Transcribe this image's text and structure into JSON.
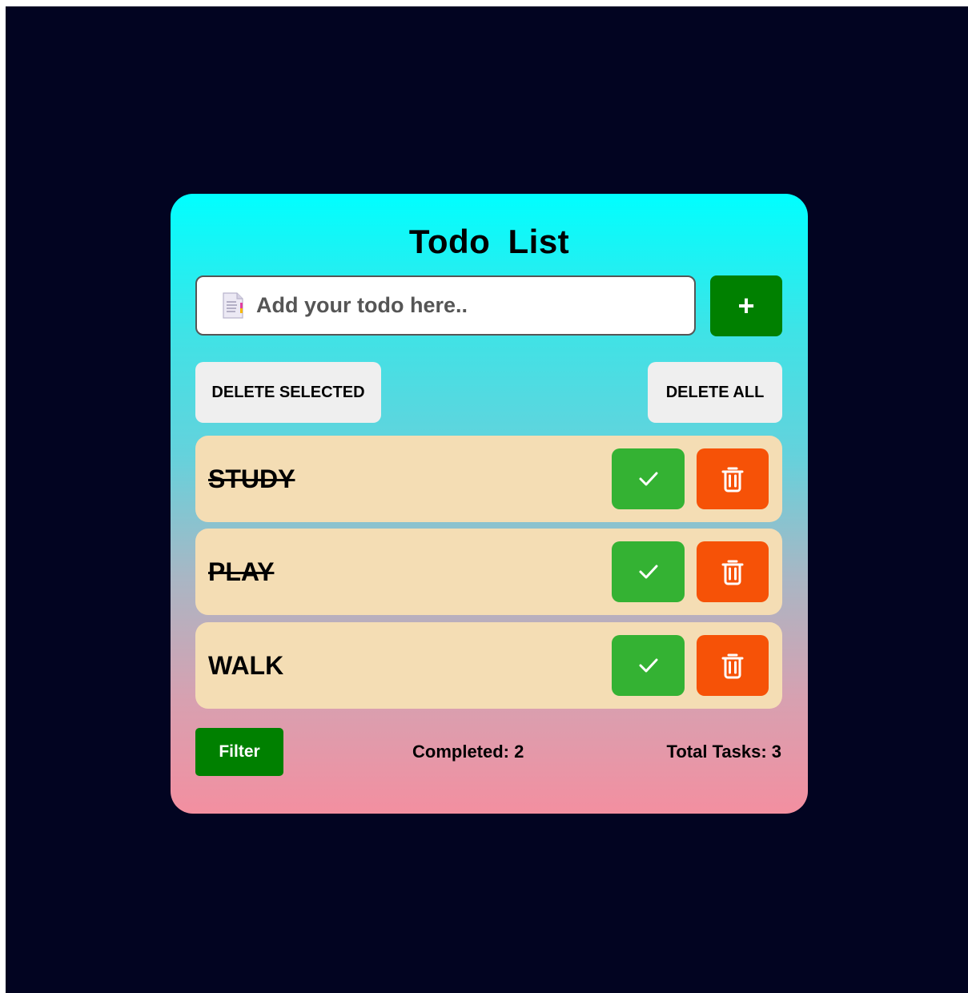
{
  "app": {
    "title": "Todo  List"
  },
  "input": {
    "placeholder": "Add your todo here..",
    "value": "",
    "icon": "notepad-icon"
  },
  "add_button": {
    "label": "+"
  },
  "actions": {
    "delete_selected_label": "DELETE SELECTED",
    "delete_all_label": "DELETE ALL"
  },
  "todos": [
    {
      "text": "STUDY",
      "completed": true
    },
    {
      "text": "PLAY",
      "completed": true
    },
    {
      "text": "WALK",
      "completed": false
    }
  ],
  "footer": {
    "filter_label": "Filter",
    "completed_text": "Completed: 2",
    "total_text": "Total Tasks: 3"
  },
  "colors": {
    "background": "#020421",
    "gradient_top": "#00ffff",
    "gradient_bottom": "#f38fa0",
    "add_button": "#008000",
    "check_button": "#34b233",
    "delete_button": "#f65207",
    "todo_item": "#f4ddb4",
    "filter_button": "#008000"
  }
}
